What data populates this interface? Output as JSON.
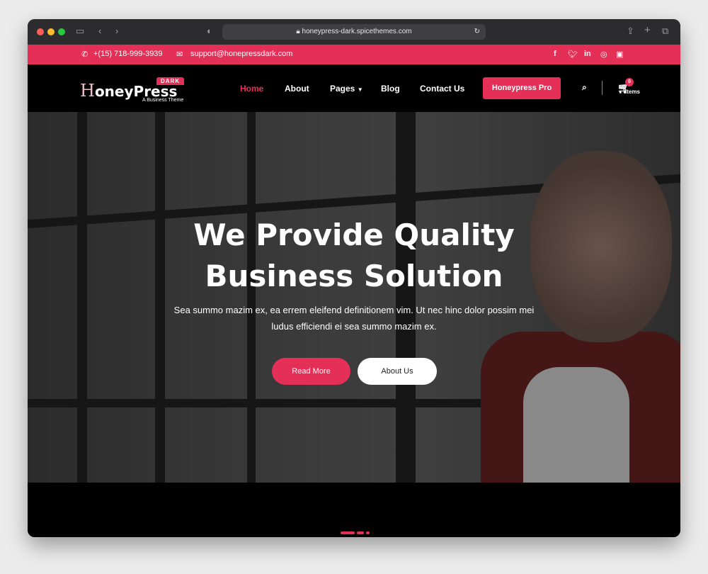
{
  "browser": {
    "url": "honeypress-dark.spicethemes.com"
  },
  "topbar": {
    "phone": "+(15) 718-999-3939",
    "email": "support@honepressdark.com",
    "social": [
      "facebook-icon",
      "twitter-icon",
      "linkedin-icon",
      "instagram-icon",
      "youtube-icon"
    ]
  },
  "logo": {
    "text_h": "H",
    "text_oney": "oney",
    "text_press": "Press",
    "badge": "DARK",
    "tagline": "A Business Theme"
  },
  "nav": {
    "items": [
      "Home",
      "About",
      "Pages",
      "Blog",
      "Contact Us"
    ],
    "active": "Home",
    "cta": "Honeypress Pro",
    "cart_count": "0",
    "cart_label": "Items"
  },
  "hero": {
    "title": "We Provide Quality Business Solution",
    "subtitle": "Sea summo mazim ex, ea errem eleifend definitionem vim. Ut nec hinc dolor possim mei ludus efficiendi ei sea summo mazim ex.",
    "primary_button": "Read More",
    "secondary_button": "About Us"
  },
  "colors": {
    "accent": "#e42f57",
    "background": "#000000"
  }
}
